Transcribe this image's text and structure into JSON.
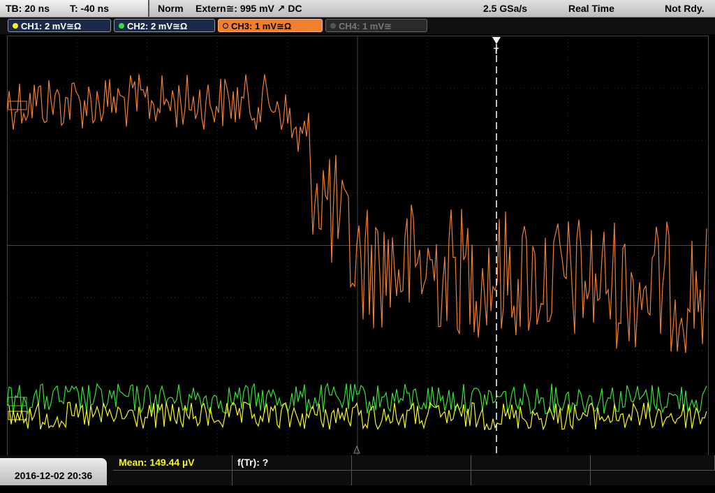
{
  "timebase": {
    "tb": "TB: 20 ns",
    "trig_pos": "T: -40 ns"
  },
  "acquisition": {
    "mode": "Norm",
    "trigger": "Extern≅: 995 mV ↗ DC",
    "sample_rate": "2.5 GSa/s",
    "realtime": "Real Time",
    "status": "Not Rdy."
  },
  "channels": [
    {
      "label": "CH1: 2 mV≅Ω",
      "color": "#f5f520",
      "active": true
    },
    {
      "label": "CH2: 2 mV≅Ω",
      "color": "#35e035",
      "active": true
    },
    {
      "label": "CH3: 1 mV≅Ω",
      "color": "#f07f2f",
      "active": true,
      "selected": true
    },
    {
      "label": "CH4: 1 mV≅",
      "color": "#777777",
      "active": false
    }
  ],
  "footer": {
    "datetime": "2016-12-02 20:36",
    "mean": "Mean: 149.44 µV",
    "ftr": "f(Tr): ?"
  },
  "trigger_marker": "T"
}
